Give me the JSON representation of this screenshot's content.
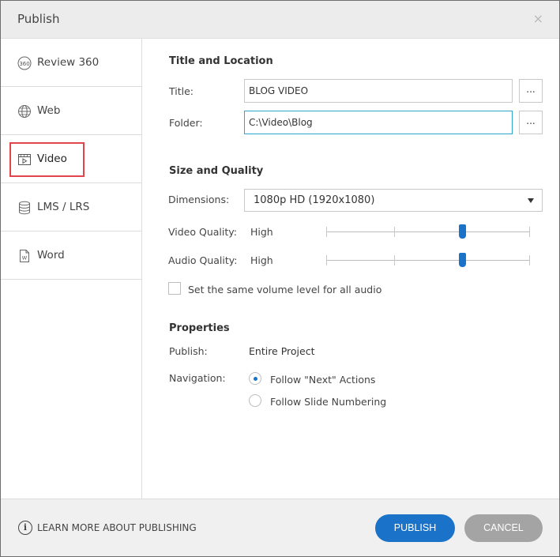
{
  "window": {
    "title": "Publish",
    "close_glyph": "×"
  },
  "sidebar": {
    "items": [
      {
        "label": "Review 360",
        "icon": "review-360-icon",
        "active": false
      },
      {
        "label": "Web",
        "icon": "globe-icon",
        "active": false
      },
      {
        "label": "Video",
        "icon": "video-icon",
        "active": true
      },
      {
        "label": "LMS / LRS",
        "icon": "database-icon",
        "active": false
      },
      {
        "label": "Word",
        "icon": "word-document-icon",
        "active": false
      }
    ]
  },
  "title_location": {
    "heading": "Title and Location",
    "title_label": "Title:",
    "title_value": "BLOG VIDEO",
    "folder_label": "Folder:",
    "folder_value": "C:\\Video\\Blog",
    "browse_label": "..."
  },
  "size_quality": {
    "heading": "Size and Quality",
    "dimensions_label": "Dimensions:",
    "dimensions_value": "1080p HD (1920x1080)",
    "video_quality_label": "Video Quality:",
    "video_quality_value": "High",
    "video_quality_level": 0.67,
    "audio_quality_label": "Audio Quality:",
    "audio_quality_value": "High",
    "audio_quality_level": 0.67,
    "same_volume_label": "Set the same volume level for all audio",
    "same_volume_checked": false
  },
  "properties": {
    "heading": "Properties",
    "publish_label": "Publish:",
    "publish_value": "Entire Project",
    "navigation_label": "Navigation:",
    "navigation_options": [
      {
        "label": "Follow \"Next\" Actions",
        "checked": true
      },
      {
        "label": "Follow Slide Numbering",
        "checked": false
      }
    ]
  },
  "footer": {
    "learn_more_label": "LEARN MORE ABOUT PUBLISHING",
    "publish_button": "PUBLISH",
    "cancel_button": "CANCEL"
  },
  "colors": {
    "accent": "#1a73c8",
    "highlight": "#e0454c",
    "focus_border": "#2fa7c9",
    "cancel": "#a4a4a4"
  }
}
